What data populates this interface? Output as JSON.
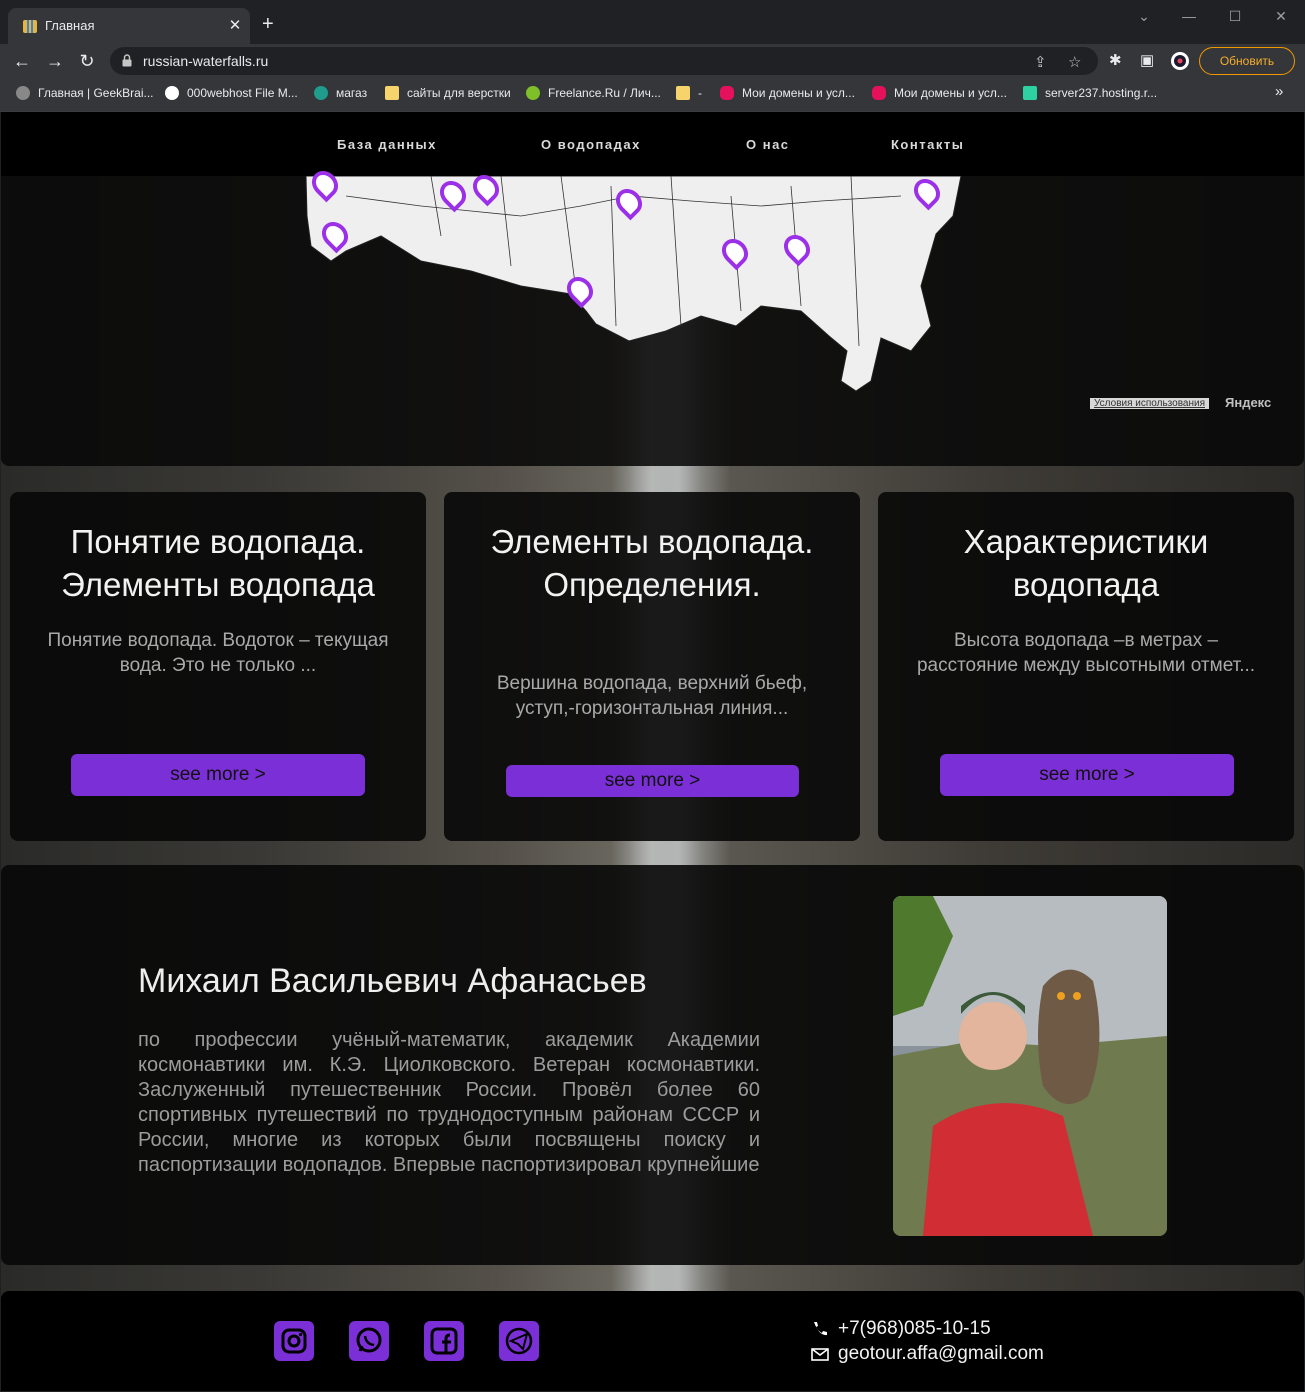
{
  "browser": {
    "tab_title": "Главная",
    "url": "russian-waterfalls.ru",
    "update_label": "Обновить",
    "bookmarks": [
      "Главная | GeekBrai...",
      "000webhost File M...",
      "магаз",
      "сайты для верстки",
      "Freelance.Ru / Лич...",
      "-",
      "Мои домены и усл...",
      "Мои домены и усл...",
      "server237.hosting.r..."
    ],
    "bookmarks_more": "»"
  },
  "nav": {
    "items": [
      "База данных",
      "О водопадах",
      "О нас",
      "Контакты"
    ]
  },
  "map": {
    "terms_label": "Условия использования",
    "logo_label": "Яндекс"
  },
  "cards": [
    {
      "title": "Понятие водопада. Элементы водопада",
      "text": "Понятие водопада. Водоток – текущая вода. Это не только ...",
      "button": "see more >"
    },
    {
      "title": "Элементы водопада. Определения.",
      "text": "Вершина водопада, верхний бьеф, уступ,-горизонтальная линия...",
      "button": "see more >"
    },
    {
      "title": "Характеристики водопада",
      "text": "Высота водопада –в метрах – расстояние между высотными отмет...",
      "button": "see more >"
    }
  ],
  "about": {
    "name": "Михаил Васильевич Афанасьев",
    "text": "по профессии учёный-математик, академик Академии космонавтики им. К.Э. Циолковского. Ветеран космонавтики. Заслуженный путешественник России. Провёл более 60 спортивных путешествий по труднодоступным районам СССР и России, многие из которых были посвящены поиску и паспортизации водопадов. Впервые паспортизировал крупнейшие"
  },
  "footer": {
    "social": [
      "instagram-icon",
      "whatsapp-icon",
      "facebook-icon",
      "telegram-icon"
    ],
    "phone": "+7(968)085-10-15",
    "email": "geotour.affa@gmail.com"
  },
  "colors": {
    "accent": "#7b2fd6",
    "pin": "#9b30e8",
    "update_border": "#f29900"
  }
}
